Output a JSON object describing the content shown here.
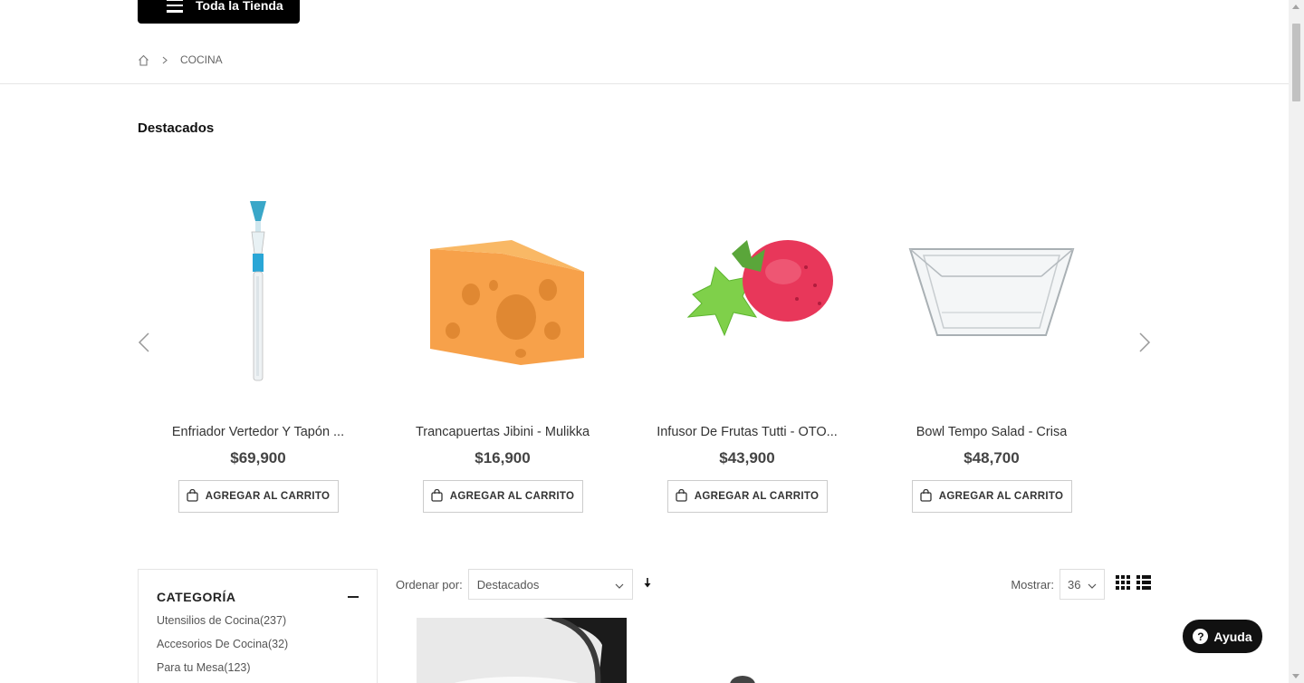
{
  "header": {
    "all_store_label": "Toda la Tienda"
  },
  "breadcrumb": {
    "current": "COCINA"
  },
  "featured": {
    "title": "Destacados",
    "products": [
      {
        "name": "Enfriador Vertedor Y Tapón ...",
        "price": "$69,900",
        "cta": "AGREGAR AL CARRITO"
      },
      {
        "name": "Trancapuertas Jibini - Mulikka",
        "price": "$16,900",
        "cta": "AGREGAR AL CARRITO"
      },
      {
        "name": "Infusor De Frutas Tutti - OTO...",
        "price": "$43,900",
        "cta": "AGREGAR AL CARRITO"
      },
      {
        "name": "Bowl Tempo Salad - Crisa",
        "price": "$48,700",
        "cta": "AGREGAR AL CARRITO"
      }
    ]
  },
  "sidebar": {
    "title": "CATEGORÍA",
    "items": [
      {
        "label": "Utensilios de Cocina(237)"
      },
      {
        "label": "Accesorios De Cocina(32)"
      },
      {
        "label": "Para tu Mesa(123)"
      }
    ]
  },
  "toolbar": {
    "sort_label": "Ordenar por:",
    "sort_value": "Destacados",
    "show_label": "Mostrar:",
    "show_value": "36"
  },
  "help": {
    "label": "Ayuda"
  },
  "icons": {
    "home": "home-icon",
    "chevron": "chevron-right-icon",
    "bag": "shopping-bag-icon",
    "grid": "grid-view-icon",
    "list": "list-view-icon",
    "sort": "sort-arrow-icon",
    "help": "help-icon"
  },
  "colors": {
    "primary": "#000000",
    "text": "#333333",
    "border": "#dddddd"
  }
}
